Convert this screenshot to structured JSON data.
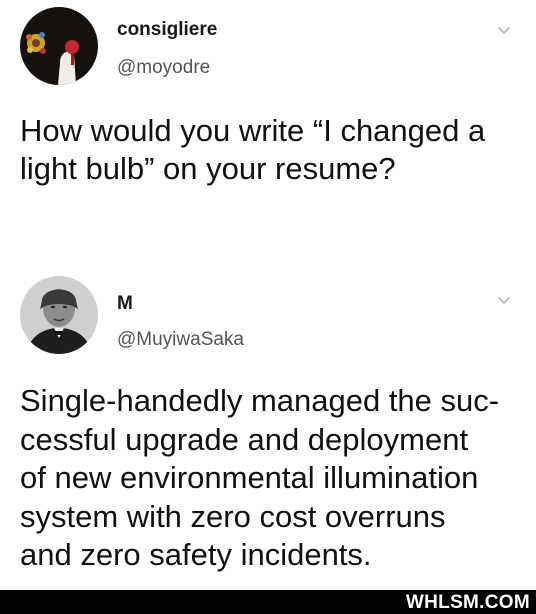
{
  "tweets": [
    {
      "display_name": "consigliere",
      "handle": "@moyodre",
      "body": "How would you write “I changed a\nlight bulb” on your resume?",
      "avatar_icon": "flower-portrait-avatar",
      "menu_icon": "chevron-down-icon"
    },
    {
      "display_name": "M",
      "handle": "@MuyiwaSaka",
      "body": "Single-handedly managed the suc-\ncessful upgrade and deployment\nof new environmental illumination\nsystem with zero cost overruns\nand zero safety incidents.",
      "avatar_icon": "vintage-portrait-avatar",
      "menu_icon": "chevron-down-icon"
    }
  ],
  "watermark": "WHLSM.COM",
  "colors": {
    "background": "#ffffff",
    "text": "#111111",
    "handle": "#555555",
    "chevron": "#b8b8b8",
    "watermark_bar": "#000000"
  }
}
